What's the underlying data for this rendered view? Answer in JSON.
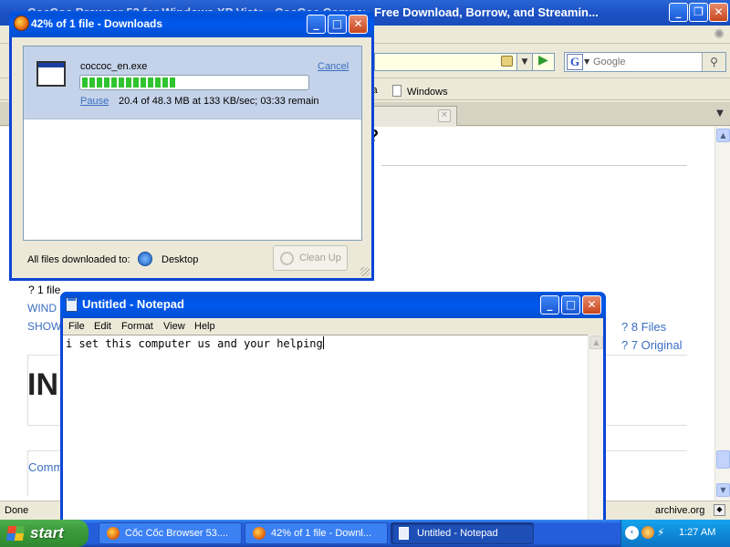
{
  "firefox": {
    "title": "Free Download, Borrow, and Streamin...",
    "title_prefix": "CocCoc Browser 53 for Windows XP Vista - CocCoc Company Limited :",
    "search": {
      "placeholder": "Google"
    },
    "bookmarks": [
      {
        "label": "dia"
      },
      {
        "label": "Windows"
      }
    ],
    "content": {
      "heading_fragment": "?",
      "files_count": "? 1 file",
      "show_link": "SHOW",
      "windows_link": "WIND",
      "files_link": "? 8 Files",
      "original_link": "? 7 Original",
      "big_heading": "IN",
      "comments_link": "Comm"
    },
    "status": {
      "left": "Done",
      "right": "archive.org"
    }
  },
  "downloads": {
    "title": "42% of 1 file - Downloads",
    "filename": "coccoc_en.exe",
    "cancel_label": "Cancel",
    "pause_label": "Pause",
    "status": "20.4 of 48.3 MB at 133 KB/sec; 03:33 remain",
    "progress": 0.42,
    "footer_label": "All files downloaded to:",
    "folder": "Desktop",
    "cleanup_label": "Clean Up"
  },
  "notepad": {
    "title": "Untitled - Notepad",
    "menu": [
      "File",
      "Edit",
      "Format",
      "View",
      "Help"
    ],
    "content": "i set this computer us and your helping"
  },
  "taskbar": {
    "start_label": "start",
    "tasks": [
      {
        "label": "Cốc Cốc Browser 53...."
      },
      {
        "label": "42% of 1 file - Downl..."
      },
      {
        "label": "Untitled - Notepad"
      }
    ],
    "clock": "1:27 AM"
  }
}
